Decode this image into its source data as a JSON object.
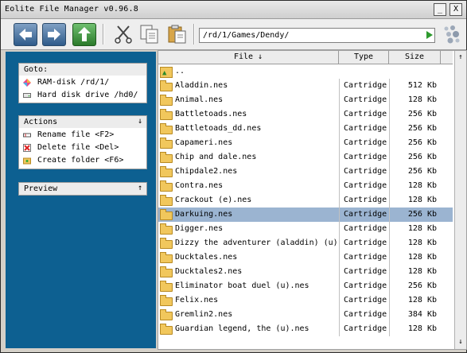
{
  "window": {
    "title": "Eolite File Manager v0.96.8",
    "minimize": "_",
    "close": "X"
  },
  "toolbar": {
    "back_icon": "left-arrow-icon",
    "forward_icon": "right-arrow-icon",
    "up_icon": "up-arrow-icon",
    "cut_icon": "scissors-icon",
    "copy_icon": "copy-icon",
    "paste_icon": "paste-icon",
    "path": "/rd/1/Games/Dendy/",
    "go_icon": "play-icon"
  },
  "sidebar": {
    "goto": {
      "title": "Goto:",
      "items": [
        {
          "label": "RAM-disk /rd/1/",
          "icon": "ramdisk-icon"
        },
        {
          "label": "Hard disk drive /hd0/",
          "icon": "hdd-icon"
        }
      ]
    },
    "actions": {
      "title": "Actions",
      "collapse": "↓",
      "items": [
        {
          "label": "Rename file <F2>",
          "icon": "rename-icon"
        },
        {
          "label": "Delete file <Del>",
          "icon": "delete-icon"
        },
        {
          "label": "Create folder <F6>",
          "icon": "new-folder-icon"
        }
      ]
    },
    "preview": {
      "title": "Preview",
      "collapse": "↑"
    }
  },
  "filelist": {
    "columns": {
      "name": "File ↓",
      "type": "Type",
      "size": "Size"
    },
    "parent": "..",
    "selected_index": 9,
    "rows": [
      {
        "name": "Aladdin.nes",
        "type": "Cartridge",
        "size": "512 Kb"
      },
      {
        "name": "Animal.nes",
        "type": "Cartridge",
        "size": "128 Kb"
      },
      {
        "name": "Battletoads.nes",
        "type": "Cartridge",
        "size": "256 Kb"
      },
      {
        "name": "Battletoads_dd.nes",
        "type": "Cartridge",
        "size": "256 Kb"
      },
      {
        "name": "Capameri.nes",
        "type": "Cartridge",
        "size": "256 Kb"
      },
      {
        "name": "Chip and dale.nes",
        "type": "Cartridge",
        "size": "256 Kb"
      },
      {
        "name": "Chipdale2.nes",
        "type": "Cartridge",
        "size": "256 Kb"
      },
      {
        "name": "Contra.nes",
        "type": "Cartridge",
        "size": "128 Kb"
      },
      {
        "name": "Crackout (e).nes",
        "type": "Cartridge",
        "size": "128 Kb"
      },
      {
        "name": "Darkuing.nes",
        "type": "Cartridge",
        "size": "256 Kb"
      },
      {
        "name": "Digger.nes",
        "type": "Cartridge",
        "size": "128 Kb"
      },
      {
        "name": "Dizzy the adventurer (aladdin) (u)",
        "type": "Cartridge",
        "size": "128 Kb"
      },
      {
        "name": "Ducktales.nes",
        "type": "Cartridge",
        "size": "128 Kb"
      },
      {
        "name": "Ducktales2.nes",
        "type": "Cartridge",
        "size": "128 Kb"
      },
      {
        "name": "Eliminator boat duel (u).nes",
        "type": "Cartridge",
        "size": "256 Kb"
      },
      {
        "name": "Felix.nes",
        "type": "Cartridge",
        "size": "128 Kb"
      },
      {
        "name": "Gremlin2.nes",
        "type": "Cartridge",
        "size": "384 Kb"
      },
      {
        "name": "Guardian legend, the (u).nes",
        "type": "Cartridge",
        "size": "128 Kb"
      }
    ]
  },
  "scrollbar": {
    "up": "↑",
    "down": "↓"
  },
  "colors": {
    "sidebar_bg": "#0d6091",
    "selection": "#9bb4d1"
  }
}
